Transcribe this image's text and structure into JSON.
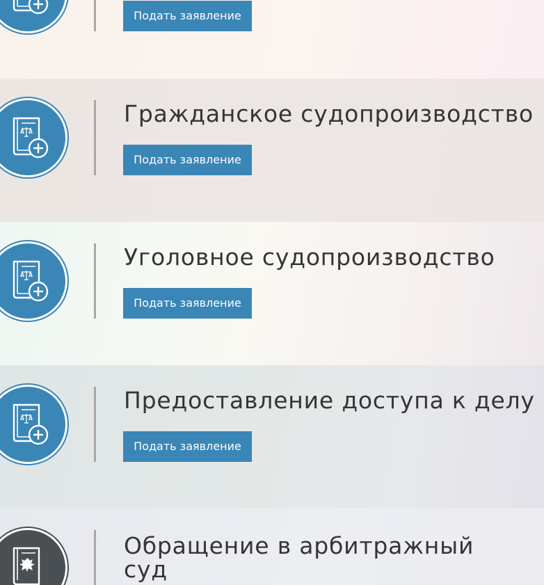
{
  "services": [
    {
      "title": "",
      "button_label": "Подать заявление",
      "icon": "law-book-add-icon"
    },
    {
      "title": "Гражданское судопроизводство",
      "button_label": "Подать заявление",
      "icon": "law-book-add-icon"
    },
    {
      "title": "Уголовное судопроизводство",
      "button_label": "Подать заявление",
      "icon": "law-book-add-icon"
    },
    {
      "title": "Предоставление доступа к делу",
      "button_label": "Подать заявление",
      "icon": "law-book-add-icon"
    },
    {
      "title": "Обращение в арбитражный суд",
      "button_label": "",
      "icon": "russian-emblem-book-icon"
    }
  ],
  "colors": {
    "accent": "#3a86b6",
    "emblem_icon": "#4a4f53",
    "title_text": "#353535",
    "divider": "#aaa6a3"
  }
}
